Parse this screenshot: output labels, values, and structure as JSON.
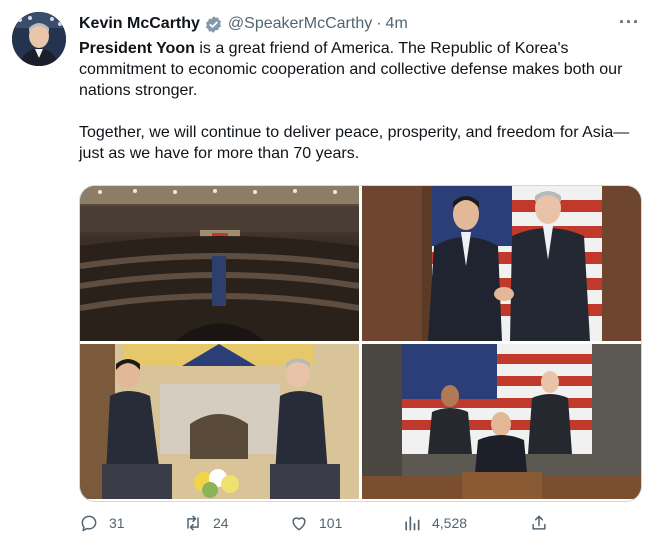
{
  "author": {
    "name": "Kevin McCarthy",
    "handle": "@SpeakerMcCarthy",
    "time": "4m",
    "verified_icon": "verified-badge-icon"
  },
  "tweet": {
    "mention": "President Yoon",
    "line1_rest": " is a great friend of America. The Republic of Korea's commitment to economic cooperation and collective defense makes both our nations stronger.",
    "paragraph2": "Together, we will continue to deliver peace, prosperity, and freedom for Asia—just as we have for more than 70 years."
  },
  "media": [
    {
      "icon": "house-chamber-photo"
    },
    {
      "icon": "handshake-photo"
    },
    {
      "icon": "seated-meeting-photo"
    },
    {
      "icon": "address-congress-photo"
    }
  ],
  "actions": {
    "reply_count": "31",
    "retweet_count": "24",
    "like_count": "101",
    "views_count": "4,528"
  },
  "colors": {
    "text": "#0f1419",
    "secondary": "#536471",
    "verified": "#829aab",
    "border": "#cfd9de"
  }
}
